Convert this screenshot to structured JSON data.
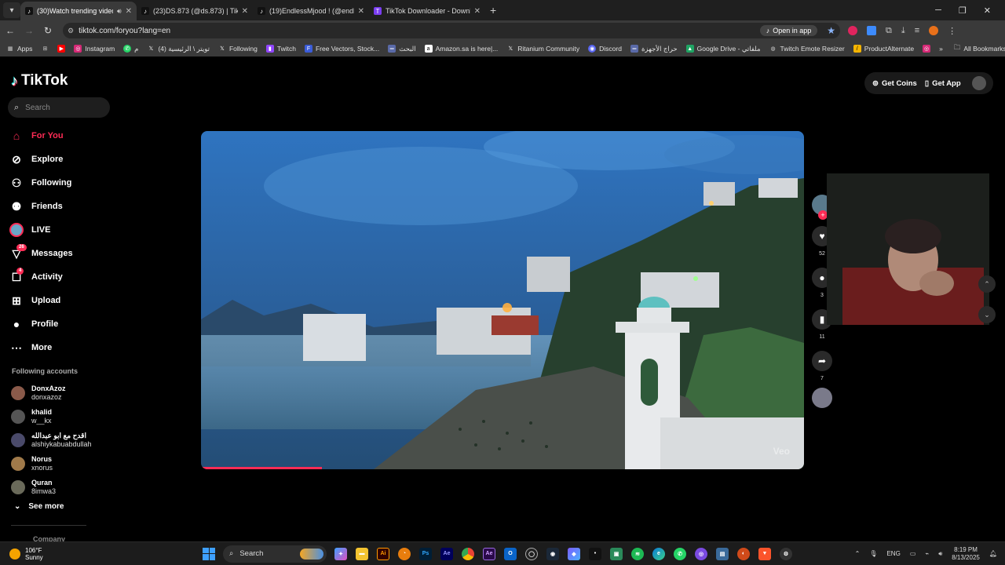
{
  "browser": {
    "tabs": [
      {
        "label": "(30)Watch trending videos",
        "active": true,
        "audio": true
      },
      {
        "label": "(23)DS.873 (@ds.873) | TikTok",
        "active": false
      },
      {
        "label": "(19)EndlessMjood ! (@endlessm",
        "active": false
      },
      {
        "label": "TikTok Downloader - Downloa",
        "active": false
      }
    ],
    "url": "tiktok.com/foryou?lang=en",
    "open_in_app": "Open in app",
    "bookmarks": [
      {
        "label": "Apps"
      },
      {
        "label": ""
      },
      {
        "label": "Instagram"
      },
      {
        "label": "م"
      },
      {
        "label": "تويتر \\ الرئيسية (4)"
      },
      {
        "label": "Following"
      },
      {
        "label": "Twitch"
      },
      {
        "label": "Free Vectors, Stock..."
      },
      {
        "label": "البحث"
      },
      {
        "label": "Amazon.sa is here|..."
      },
      {
        "label": "Ritanium Community"
      },
      {
        "label": "Discord"
      },
      {
        "label": "حراج الأجهزة"
      },
      {
        "label": "Google Drive - ملفاتي"
      },
      {
        "label": "Twitch Emote Resizer"
      },
      {
        "label": "ProductAlternate"
      }
    ],
    "all_bookmarks": "All Bookmarks"
  },
  "tiktok": {
    "logo": "TikTok",
    "search_placeholder": "Search",
    "nav": [
      {
        "label": "For You",
        "active": true
      },
      {
        "label": "Explore"
      },
      {
        "label": "Following"
      },
      {
        "label": "Friends"
      },
      {
        "label": "LIVE"
      },
      {
        "label": "Messages",
        "badge": "26"
      },
      {
        "label": "Activity",
        "badge": "4"
      },
      {
        "label": "Upload"
      },
      {
        "label": "Profile"
      },
      {
        "label": "More"
      }
    ],
    "following_title": "Following accounts",
    "following_accounts": [
      {
        "name": "DonxAzoz",
        "handle": "donxazoz"
      },
      {
        "name": "khalid",
        "handle": "w__kx"
      },
      {
        "name": "اقدح مع ابو عبدالله",
        "handle": "alshiykabuabdullah"
      },
      {
        "name": "Norus",
        "handle": "xnorus"
      },
      {
        "name": "Quran",
        "handle": "8imwa3"
      }
    ],
    "see_more": "See more",
    "company": "Company",
    "get_coins": "Get Coins",
    "get_app": "Get App",
    "video": {
      "watermark": "Veo",
      "progress": 0.2
    },
    "actions": {
      "likes": "52",
      "comments": "3",
      "saves": "11",
      "shares": "7"
    }
  },
  "taskbar": {
    "temperature": "106°F",
    "condition": "Sunny",
    "search": "Search",
    "language": "ENG",
    "time": "8:19 PM",
    "date": "8/13/2025"
  },
  "colors": {
    "accent": "#fe2c55",
    "cyan": "#25f4ee"
  }
}
